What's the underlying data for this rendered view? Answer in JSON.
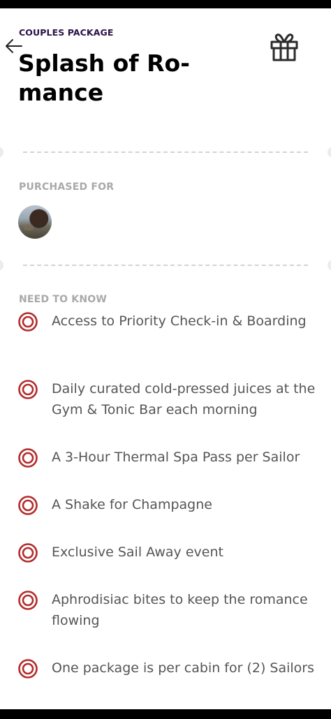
{
  "header": {
    "eyebrow": "COUPLES PACKAGE",
    "title": "Splash of Ro-\nmance",
    "back_icon": "arrow-left-icon",
    "gift_icon": "gift-icon"
  },
  "purchased_for": {
    "label": "PURCHASED FOR",
    "avatar": "user-avatar"
  },
  "need_to_know": {
    "label": "NEED TO KNOW",
    "bullet_icon": "target-ring-icon",
    "accent_color": "#b42b2b",
    "items": [
      "Access to Priority Check-in & Boarding",
      "Daily curated cold-pressed juices at the Gym & Tonic Bar each morning",
      "A 3-Hour Thermal Spa Pass per Sailor",
      "A Shake for Champagne",
      "Exclusive Sail Away event",
      "Aphrodisiac bites to keep the romance flowing",
      "One package is per cabin for (2) Sailors"
    ]
  }
}
